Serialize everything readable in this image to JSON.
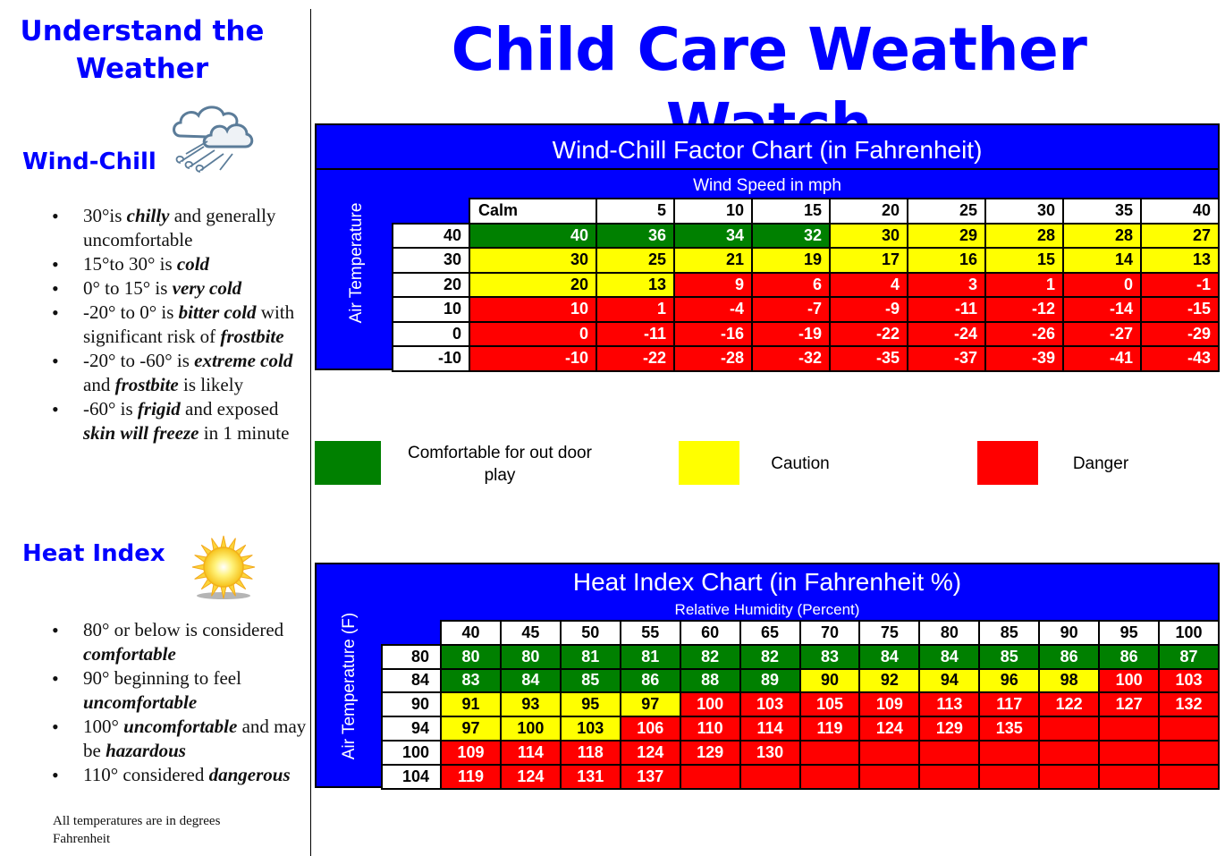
{
  "sidebar": {
    "title": "Understand the Weather",
    "wind_chill": {
      "heading": "Wind-Chill",
      "icon": "cloud-wind-icon",
      "bullets": [
        [
          {
            "t": "30°is "
          },
          {
            "t": "chilly",
            "em": true
          },
          {
            "t": " and generally uncomfortable"
          }
        ],
        [
          {
            "t": "15°to 30° is "
          },
          {
            "t": "cold",
            "em": true
          }
        ],
        [
          {
            "t": "0° to 15° is "
          },
          {
            "t": "very cold",
            "em": true
          }
        ],
        [
          {
            "t": "-20° to 0° is "
          },
          {
            "t": "bitter cold",
            "em": true
          },
          {
            "t": " with significant  risk of "
          },
          {
            "t": "frostbite",
            "em": true
          }
        ],
        [
          {
            "t": "-20° to -60° is "
          },
          {
            "t": "extreme cold",
            "em": true
          },
          {
            "t": " and "
          },
          {
            "t": "frostbite",
            "em": true
          },
          {
            "t": " is likely"
          }
        ],
        [
          {
            "t": "-60° is "
          },
          {
            "t": "frigid",
            "em": true
          },
          {
            "t": " and exposed "
          },
          {
            "t": "skin will freeze",
            "em": true
          },
          {
            "t": " in 1 minute"
          }
        ]
      ]
    },
    "heat_index": {
      "heading": "Heat Index",
      "icon": "sun-icon",
      "bullets": [
        [
          {
            "t": "80° or below is considered "
          },
          {
            "t": "comfortable",
            "em": true
          }
        ],
        [
          {
            "t": "90° beginning to feel "
          },
          {
            "t": "uncomfortable",
            "em": true
          }
        ],
        [
          {
            "t": "100° "
          },
          {
            "t": "uncomfortable",
            "em": true
          },
          {
            "t": " and may be "
          },
          {
            "t": "hazardous",
            "em": true
          }
        ],
        [
          {
            "t": "110° considered "
          },
          {
            "t": "dangerous",
            "em": true
          }
        ]
      ]
    },
    "footnote": "All temperatures are in degrees Fahrenheit"
  },
  "main_title": "Child Care Weather Watch",
  "colors": {
    "green": "#008000",
    "yellow": "#ffff00",
    "red": "#ff0000",
    "brand_blue": "#0000ff"
  },
  "legend": [
    {
      "key": "g",
      "label": "Comfortable for out door play"
    },
    {
      "key": "y",
      "label": "Caution"
    },
    {
      "key": "r",
      "label": "Danger"
    }
  ],
  "chart_data": [
    {
      "type": "table",
      "title": "Wind-Chill Factor Chart (in Fahrenheit)",
      "xlabel": "Wind Speed in mph",
      "ylabel": "Air Temperature",
      "columns": [
        "Calm",
        "5",
        "10",
        "15",
        "20",
        "25",
        "30",
        "35",
        "40"
      ],
      "rows": [
        {
          "temp": "40",
          "values": [
            40,
            36,
            34,
            32,
            30,
            29,
            28,
            28,
            27
          ],
          "levels": [
            "g",
            "g",
            "g",
            "g",
            "y",
            "y",
            "y",
            "y",
            "y"
          ]
        },
        {
          "temp": "30",
          "values": [
            30,
            25,
            21,
            19,
            17,
            16,
            15,
            14,
            13
          ],
          "levels": [
            "y",
            "y",
            "y",
            "y",
            "y",
            "y",
            "y",
            "y",
            "y"
          ]
        },
        {
          "temp": "20",
          "values": [
            20,
            13,
            9,
            6,
            4,
            3,
            1,
            0,
            -1
          ],
          "levels": [
            "y",
            "y",
            "r",
            "r",
            "r",
            "r",
            "r",
            "r",
            "r"
          ]
        },
        {
          "temp": "10",
          "values": [
            10,
            1,
            -4,
            -7,
            -9,
            -11,
            -12,
            -14,
            -15
          ],
          "levels": [
            "r",
            "r",
            "r",
            "r",
            "r",
            "r",
            "r",
            "r",
            "r"
          ]
        },
        {
          "temp": "0",
          "values": [
            0,
            -11,
            -16,
            -19,
            -22,
            -24,
            -26,
            -27,
            -29
          ],
          "levels": [
            "r",
            "r",
            "r",
            "r",
            "r",
            "r",
            "r",
            "r",
            "r"
          ]
        },
        {
          "temp": "-10",
          "values": [
            -10,
            -22,
            -28,
            -32,
            -35,
            -37,
            -39,
            -41,
            -43
          ],
          "levels": [
            "r",
            "r",
            "r",
            "r",
            "r",
            "r",
            "r",
            "r",
            "r"
          ]
        }
      ]
    },
    {
      "type": "table",
      "title": "Heat Index Chart (in Fahrenheit %)",
      "xlabel": "Relative Humidity (Percent)",
      "ylabel": "Air Temperature (F)",
      "columns": [
        "40",
        "45",
        "50",
        "55",
        "60",
        "65",
        "70",
        "75",
        "80",
        "85",
        "90",
        "95",
        "100"
      ],
      "rows": [
        {
          "temp": "80",
          "values": [
            80,
            80,
            81,
            81,
            82,
            82,
            83,
            84,
            84,
            85,
            86,
            86,
            87
          ],
          "levels": [
            "g",
            "g",
            "g",
            "g",
            "g",
            "g",
            "g",
            "g",
            "g",
            "g",
            "g",
            "g",
            "g"
          ]
        },
        {
          "temp": "84",
          "values": [
            83,
            84,
            85,
            86,
            88,
            89,
            90,
            92,
            94,
            96,
            98,
            100,
            103
          ],
          "levels": [
            "g",
            "g",
            "g",
            "g",
            "g",
            "g",
            "y",
            "y",
            "y",
            "y",
            "y",
            "r",
            "r"
          ]
        },
        {
          "temp": "90",
          "values": [
            91,
            93,
            95,
            97,
            100,
            103,
            105,
            109,
            113,
            117,
            122,
            127,
            132
          ],
          "levels": [
            "y",
            "y",
            "y",
            "y",
            "r",
            "r",
            "r",
            "r",
            "r",
            "r",
            "r",
            "r",
            "r"
          ]
        },
        {
          "temp": "94",
          "values": [
            97,
            100,
            103,
            106,
            110,
            114,
            119,
            124,
            129,
            135,
            null,
            null,
            null
          ],
          "levels": [
            "y",
            "y",
            "y",
            "r",
            "r",
            "r",
            "r",
            "r",
            "r",
            "r",
            "r",
            "r",
            "r"
          ]
        },
        {
          "temp": "100",
          "values": [
            109,
            114,
            118,
            124,
            129,
            130,
            null,
            null,
            null,
            null,
            null,
            null,
            null
          ],
          "levels": [
            "r",
            "r",
            "r",
            "r",
            "r",
            "r",
            "r",
            "r",
            "r",
            "r",
            "r",
            "r",
            "r"
          ]
        },
        {
          "temp": "104",
          "values": [
            119,
            124,
            131,
            137,
            null,
            null,
            null,
            null,
            null,
            null,
            null,
            null,
            null
          ],
          "levels": [
            "r",
            "r",
            "r",
            "r",
            "r",
            "r",
            "r",
            "r",
            "r",
            "r",
            "r",
            "r",
            "r"
          ]
        }
      ]
    }
  ]
}
